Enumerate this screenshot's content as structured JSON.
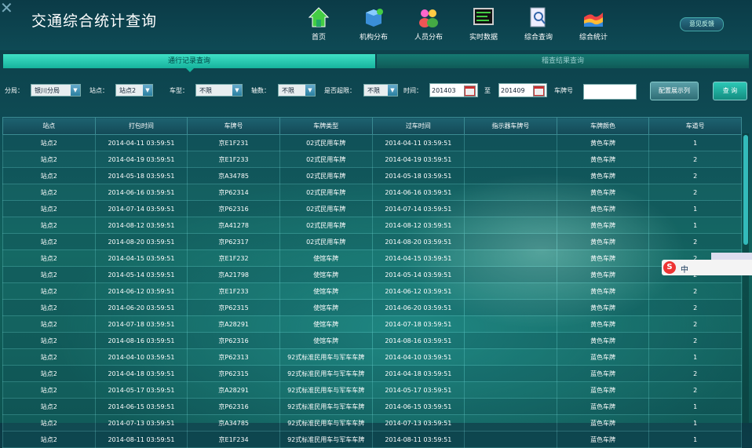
{
  "app": {
    "title": "交通综合统计查询",
    "close_glyph": "✕",
    "feedback_label": "意见反馈"
  },
  "nav": [
    {
      "label": "首页",
      "icon": "home-icon"
    },
    {
      "label": "机构分布",
      "icon": "org-cube-icon"
    },
    {
      "label": "人员分布",
      "icon": "people-icon"
    },
    {
      "label": "实时数据",
      "icon": "realtime-screen-icon"
    },
    {
      "label": "综合查询",
      "icon": "search-doc-icon"
    },
    {
      "label": "综合统计",
      "icon": "stats-chart-icon"
    }
  ],
  "tabs": {
    "active": "通行记录查询",
    "idle": "稽查结果查询"
  },
  "filters": {
    "branch_label": "分局：",
    "branch_value": "银川分局",
    "site_label": "站点：",
    "site_value": "站点2",
    "vtype_label": "车型：",
    "vtype_value": "不限",
    "axles_label": "轴数：",
    "axles_value": "不限",
    "overlimit_label": "是否超限：",
    "overlimit_value": "不限",
    "time_label": "时间：",
    "time_from": "201403",
    "to_label": "至",
    "time_to": "201409",
    "plate_label": "车牌号",
    "plate_value": "",
    "config_btn": "配置展示列",
    "query_btn": "查 询"
  },
  "table": {
    "columns": [
      "站点",
      "打包时间",
      "车牌号",
      "车牌类型",
      "过车时间",
      "指示器车牌号",
      "车牌颜色",
      "车道号"
    ],
    "rows": [
      [
        "站点2",
        "2014-04-11 03:59:51",
        "京E1F231",
        "02式民用车牌",
        "2014-04-11 03:59:51",
        "",
        "黄色车牌",
        "1"
      ],
      [
        "站点2",
        "2014-04-19 03:59:51",
        "京E1F233",
        "02式民用车牌",
        "2014-04-19 03:59:51",
        "",
        "黄色车牌",
        "2"
      ],
      [
        "站点2",
        "2014-05-18 03:59:51",
        "京A34785",
        "02式民用车牌",
        "2014-05-18 03:59:51",
        "",
        "黄色车牌",
        "2"
      ],
      [
        "站点2",
        "2014-06-16 03:59:51",
        "京P62314",
        "02式民用车牌",
        "2014-06-16 03:59:51",
        "",
        "黄色车牌",
        "2"
      ],
      [
        "站点2",
        "2014-07-14 03:59:51",
        "京P62316",
        "02式民用车牌",
        "2014-07-14 03:59:51",
        "",
        "黄色车牌",
        "1"
      ],
      [
        "站点2",
        "2014-08-12 03:59:51",
        "京A41278",
        "02式民用车牌",
        "2014-08-12 03:59:51",
        "",
        "黄色车牌",
        "1"
      ],
      [
        "站点2",
        "2014-08-20 03:59:51",
        "京P62317",
        "02式民用车牌",
        "2014-08-20 03:59:51",
        "",
        "黄色车牌",
        "2"
      ],
      [
        "站点2",
        "2014-04-15 03:59:51",
        "京E1F232",
        "使馆车牌",
        "2014-04-15 03:59:51",
        "",
        "黄色车牌",
        "2"
      ],
      [
        "站点2",
        "2014-05-14 03:59:51",
        "京A21798",
        "使馆车牌",
        "2014-05-14 03:59:51",
        "",
        "黄色车牌",
        "2"
      ],
      [
        "站点2",
        "2014-06-12 03:59:51",
        "京E1F233",
        "使馆车牌",
        "2014-06-12 03:59:51",
        "",
        "黄色车牌",
        "2"
      ],
      [
        "站点2",
        "2014-06-20 03:59:51",
        "京P62315",
        "使馆车牌",
        "2014-06-20 03:59:51",
        "",
        "黄色车牌",
        "2"
      ],
      [
        "站点2",
        "2014-07-18 03:59:51",
        "京A28291",
        "使馆车牌",
        "2014-07-18 03:59:51",
        "",
        "黄色车牌",
        "2"
      ],
      [
        "站点2",
        "2014-08-16 03:59:51",
        "京P62316",
        "使馆车牌",
        "2014-08-16 03:59:51",
        "",
        "黄色车牌",
        "2"
      ],
      [
        "站点2",
        "2014-04-10 03:59:51",
        "京P62313",
        "92式标准民用车与军车车牌",
        "2014-04-10 03:59:51",
        "",
        "蓝色车牌",
        "1"
      ],
      [
        "站点2",
        "2014-04-18 03:59:51",
        "京P62315",
        "92式标准民用车与军车车牌",
        "2014-04-18 03:59:51",
        "",
        "蓝色车牌",
        "2"
      ],
      [
        "站点2",
        "2014-05-17 03:59:51",
        "京A28291",
        "92式标准民用车与军车车牌",
        "2014-05-17 03:59:51",
        "",
        "蓝色车牌",
        "2"
      ],
      [
        "站点2",
        "2014-06-15 03:59:51",
        "京P62316",
        "92式标准民用车与军车车牌",
        "2014-06-15 03:59:51",
        "",
        "蓝色车牌",
        "1"
      ],
      [
        "站点2",
        "2014-07-13 03:59:51",
        "京A34785",
        "92式标准民用车与军车车牌",
        "2014-07-13 03:59:51",
        "",
        "蓝色车牌",
        "1"
      ],
      [
        "站点2",
        "2014-08-11 03:59:51",
        "京E1F234",
        "92式标准民用车与军车车牌",
        "2014-08-11 03:59:51",
        "",
        "蓝色车牌",
        "1"
      ]
    ]
  },
  "ime": {
    "logo": "S",
    "mode": "中"
  },
  "colors": {
    "accent": "#16b39d",
    "header_bg": "#0b3b47"
  }
}
